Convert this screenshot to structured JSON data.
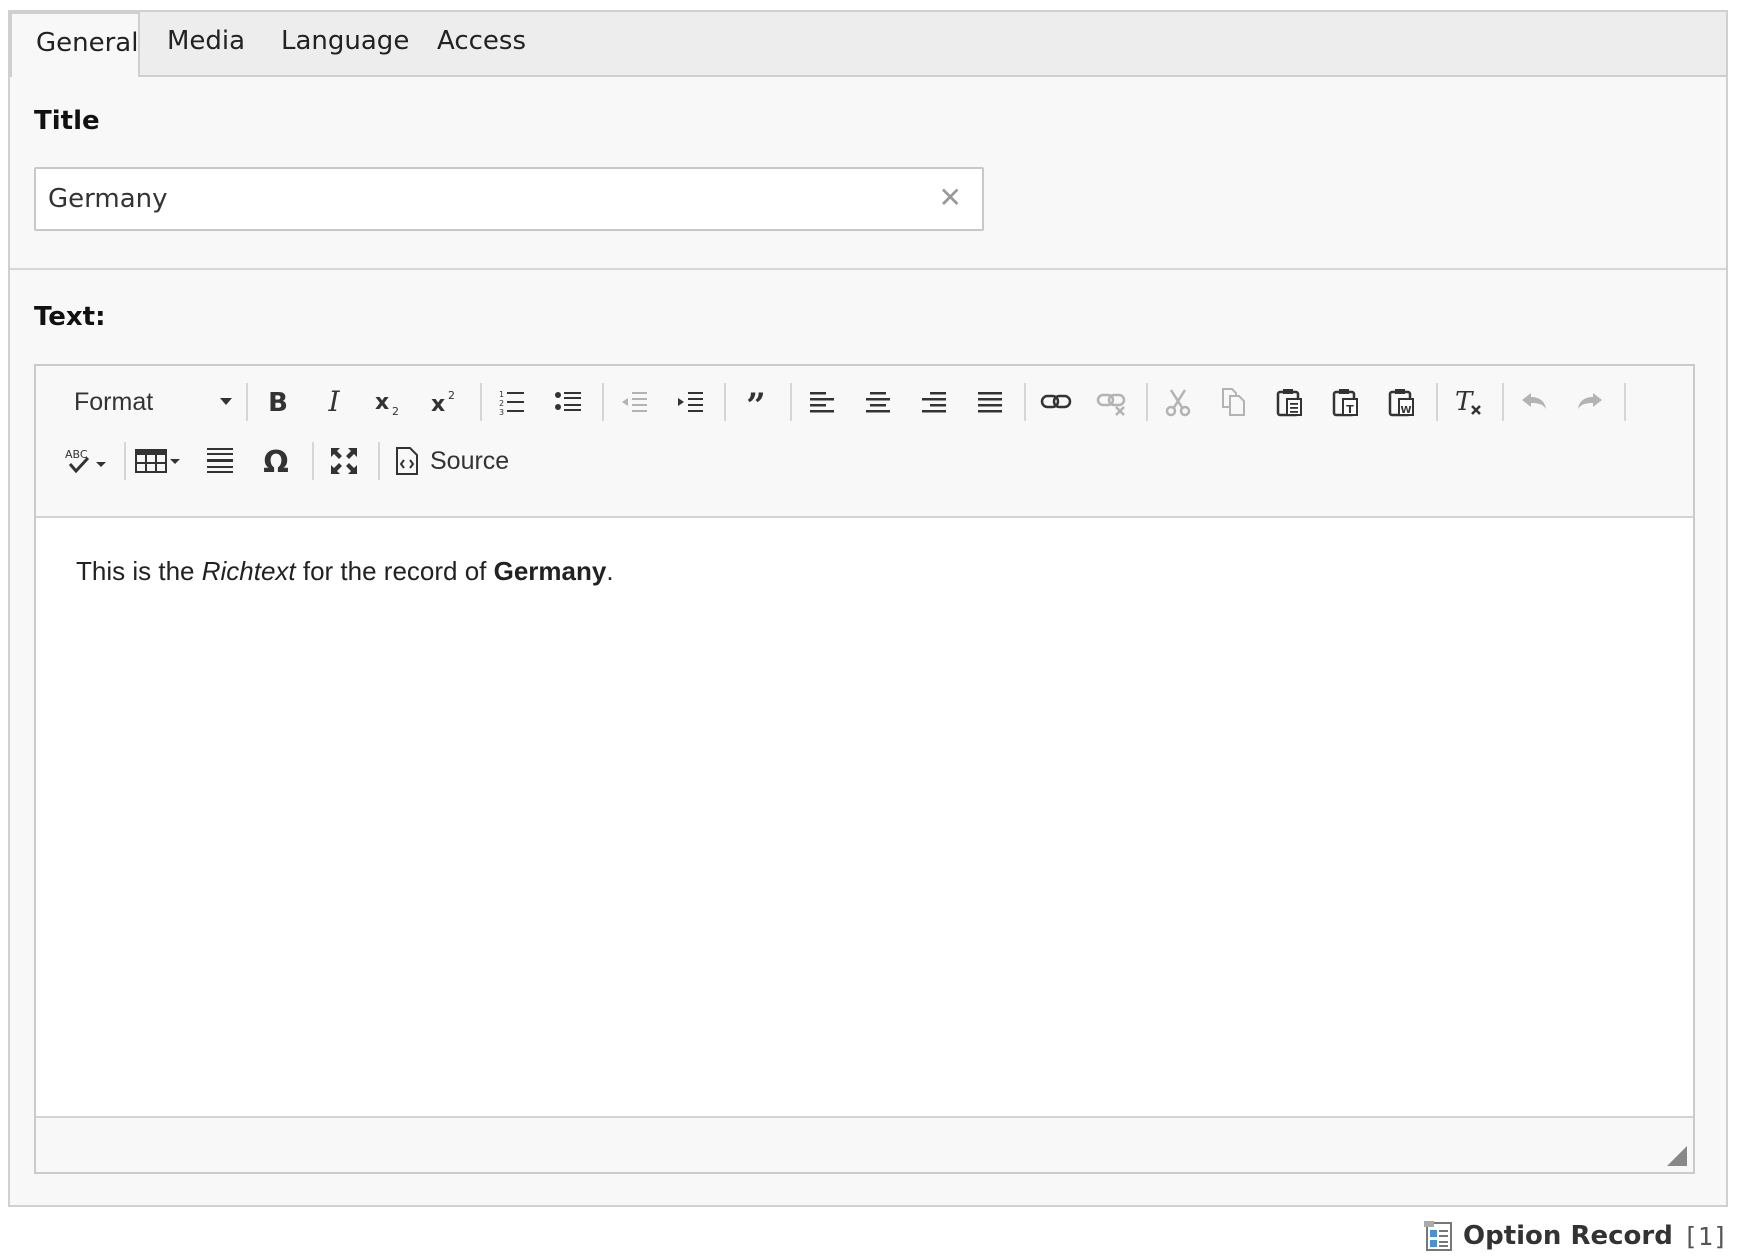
{
  "tabs": [
    {
      "label": "General",
      "active": true
    },
    {
      "label": "Media",
      "active": false
    },
    {
      "label": "Language",
      "active": false
    },
    {
      "label": "Access",
      "active": false
    }
  ],
  "title_field": {
    "label": "Title",
    "value": "Germany"
  },
  "text_field": {
    "label": "Text:"
  },
  "toolbar": {
    "format_label": "Format",
    "source_label": "Source"
  },
  "content": {
    "part1": "This is the ",
    "italic": "Richtext",
    "part2": " for the record of ",
    "bold": "Germany",
    "part3": "."
  },
  "footer": {
    "record_label": "Option Record",
    "record_uid": "[1]"
  },
  "colors": {
    "frame_bg": "#f8f8f8",
    "tabbar_bg": "#ededed",
    "icon": "#333333",
    "disabled_icon": "#b3b3b3"
  }
}
